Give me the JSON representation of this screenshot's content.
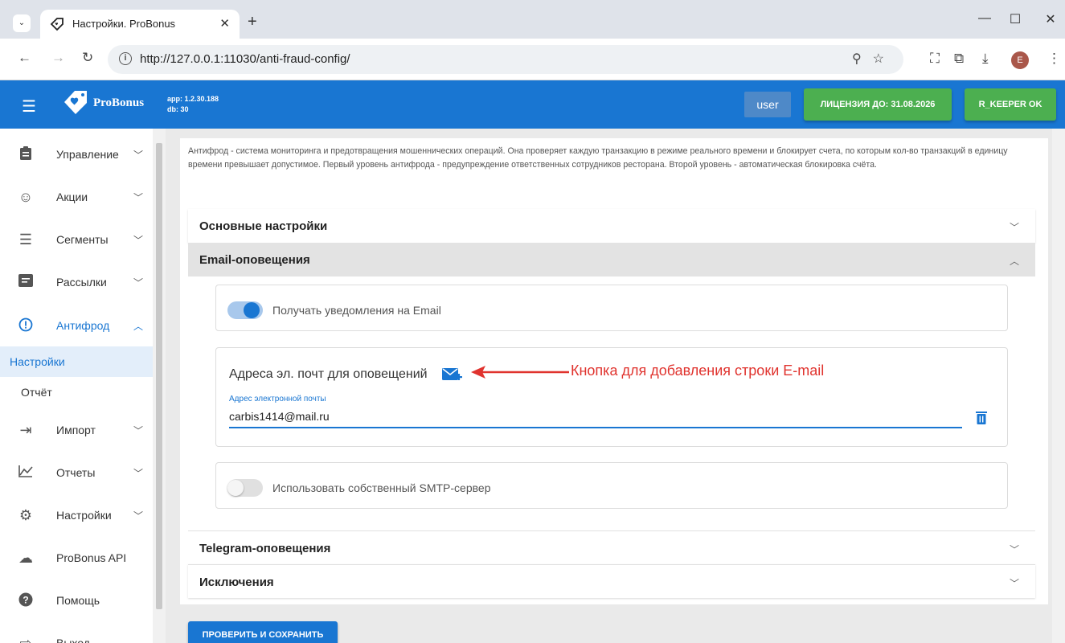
{
  "browser": {
    "tab_title": "Настройки. ProBonus",
    "url": "http://127.0.0.1:11030/anti-fraud-config/",
    "profile_initial": "E"
  },
  "app": {
    "logo_text": "ProBonus",
    "version_app": "app: 1.2.30.188",
    "version_db": "db: 30",
    "user_button": "user",
    "license_button": "ЛИЦЕНЗИЯ ДО: 31.08.2026",
    "rkeeper_button": "R_KEEPER OK",
    "green_color": "#4caf50",
    "primary_color": "#1976d2"
  },
  "sidebar": {
    "items": [
      {
        "label": "Управление",
        "icon": "clipboard-icon"
      },
      {
        "label": "Акции",
        "icon": "smile-icon"
      },
      {
        "label": "Сегменты",
        "icon": "list-icon"
      },
      {
        "label": "Рассылки",
        "icon": "mail-list-icon"
      },
      {
        "label": "Антифрод",
        "icon": "alert-icon"
      },
      {
        "label": "Импорт",
        "icon": "import-icon"
      },
      {
        "label": "Отчеты",
        "icon": "chart-icon"
      },
      {
        "label": "Настройки",
        "icon": "gear-icon"
      },
      {
        "label": "ProBonus API",
        "icon": "cloud-icon"
      },
      {
        "label": "Помощь",
        "icon": "help-icon"
      },
      {
        "label": "Выход",
        "icon": "exit-icon"
      }
    ],
    "subitems": [
      {
        "label": "Настройки"
      },
      {
        "label": "Отчёт"
      }
    ]
  },
  "main": {
    "description": "Антифрод - система мониторинга и предотвращения мошеннических операций. Она проверяет каждую транзакцию в режиме реального времени и блокирует счета, по которым кол-во транзакций в единицу времени превышает допустимое. Первый уровень антифрода - предупреждение ответственных сотрудников ресторана. Второй уровень - автоматическая блокировка счёта.",
    "panels": {
      "basic": "Основные настройки",
      "email": "Email-оповещения",
      "telegram": "Telegram-оповещения",
      "exclusions": "Исключения"
    },
    "email_toggle_label": "Получать уведомления на Email",
    "email_toggle_on": true,
    "addresses_title": "Адреса эл. почт для оповещений",
    "annotation": "Кнопка для добавления строки E-mail",
    "email_field_label": "Адрес электронной почты",
    "email_value": "carbis1414@mail.ru",
    "smtp_toggle_label": "Использовать собственный SMTP-сервер",
    "smtp_toggle_on": false,
    "save_button": "ПРОВЕРИТЬ И СОХРАНИТЬ"
  }
}
